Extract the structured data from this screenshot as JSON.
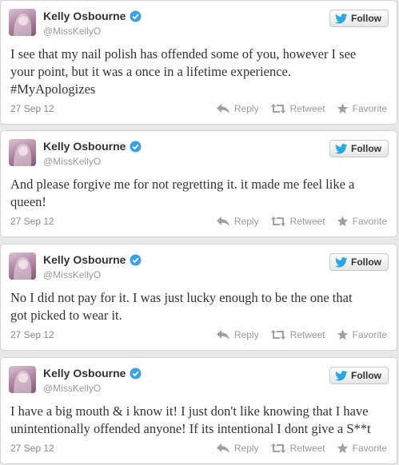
{
  "profile": {
    "name": "Kelly Osbourne",
    "handle": "@MissKellyO",
    "follow_label": "Follow"
  },
  "actions": {
    "reply": "Reply",
    "retweet": "Retweet",
    "favorite": "Favorite"
  },
  "colors": {
    "verified": "#3ba1e1",
    "twitter_blue": "#2aa9e0",
    "icon_gray": "#a0a0a0"
  },
  "tweets": [
    {
      "lines": [
        "I see that my nail polish has offended some of you, however I see",
        "your point, but it was a once in a lifetime experience.",
        "#MyApologizes"
      ],
      "date": "27 Sep 12"
    },
    {
      "lines": [
        "And please forgive me for not regretting it. it made me feel like a",
        "queen!"
      ],
      "date": "27 Sep 12"
    },
    {
      "lines": [
        "No I did not pay for it. I was just lucky enough to be the one that",
        "got picked to wear it."
      ],
      "date": "27 Sep 12"
    },
    {
      "lines": [
        "I have a big mouth & i know it! I just don't like knowing that I have",
        "unintentionally offended anyone! If its intentional I dont give a S**t"
      ],
      "date": "27 Sep 12"
    }
  ]
}
